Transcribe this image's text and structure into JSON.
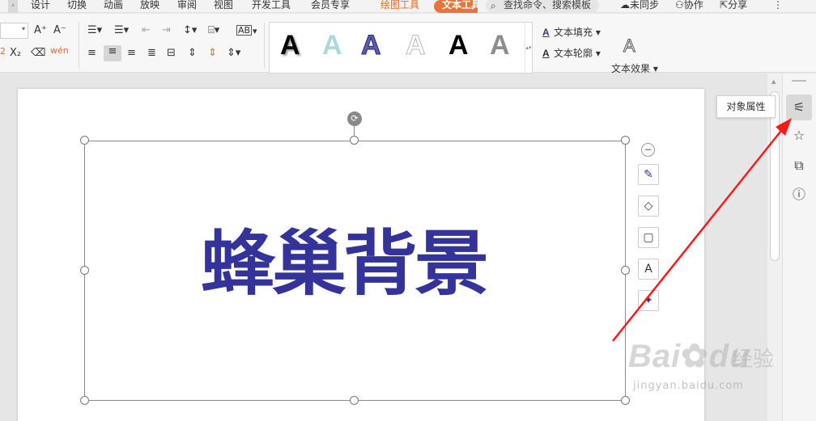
{
  "menubar": {
    "scroll_arrow": "‹",
    "tabs": [
      "设计",
      "切换",
      "动画",
      "放映",
      "审阅",
      "视图",
      "开发工具",
      "会员专享"
    ],
    "context_tabs": {
      "drawing": "绘图工具",
      "text": "文本工具"
    },
    "search_placeholder": "查找命令、搜索模板",
    "sync": "未同步",
    "collab": "协作",
    "share": "分享",
    "more": "⋮"
  },
  "ribbon": {
    "font_size_up": "A⁺",
    "font_size_down": "A⁻",
    "subscript_label": "X₂",
    "superscript_mark": "2",
    "pinyin_label": "wén",
    "text_direction": "AB",
    "wordart_glyph": "A",
    "text_fill": "文本填充",
    "text_outline": "文本轮廓",
    "text_effect": "文本效果"
  },
  "canvas": {
    "headline": "蜂巢背景",
    "headline_color": "#333399"
  },
  "right_rail": {
    "tooltip": "对象属性",
    "buttons": [
      "object-properties-icon",
      "star-icon",
      "transition-icon",
      "help-icon"
    ]
  },
  "watermark": {
    "brand": "Bai",
    "brand_tail": "du",
    "cn": "经验",
    "url": "jingyan.baidu.com"
  },
  "colors": {
    "accent_orange": "#e8743b",
    "arrow_red": "#ff1a1a"
  }
}
